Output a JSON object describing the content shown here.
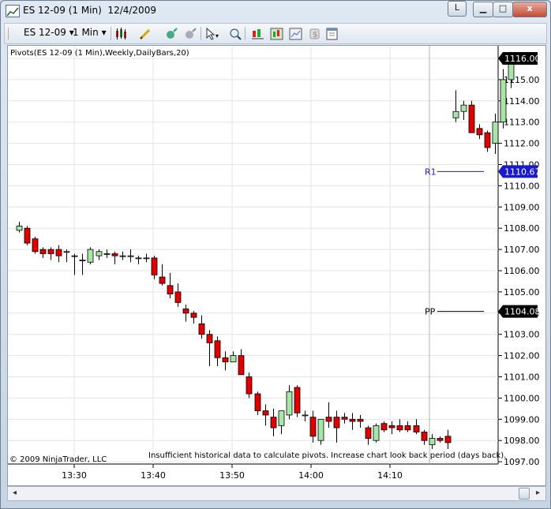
{
  "window": {
    "title": "ES 12-09 (1 Min)  12/4/2009",
    "minimize_label": "▁",
    "maximize_label": "□",
    "close_label": "x",
    "restore_label": "L"
  },
  "toolbar": {
    "instrument": "ES 12-09",
    "interval": "1 Min",
    "dropdown_glyph": "▾",
    "icons": [
      "bar-type-icon",
      "drawing-tools-icon",
      "indicators-icon",
      "strategies-icon",
      "cursor-icon",
      "zoom-icon",
      "data-box-icon",
      "chart-style-icon",
      "properties-icon",
      "reset-icon",
      "print-icon"
    ]
  },
  "chart": {
    "indicator_label": "Pivots(ES 12-09 (1 Min),Weekly,DailyBars,20)",
    "copyright": "© 2009 NinjaTrader, LLC",
    "message": "Insufficient historical data to calculate pivots. Increase chart look back period (days back).",
    "price_labels": [
      "1116.00",
      "1115.00",
      "1114.00",
      "1113.00",
      "1112.00",
      "1111.00",
      "1110.00",
      "1109.00",
      "1108.00",
      "1107.00",
      "1106.00",
      "1105.00",
      "1104.00",
      "1103.00",
      "1102.00",
      "1101.00",
      "1100.00",
      "1099.00",
      "1098.00",
      "1097.00"
    ],
    "time_labels": [
      "13:30",
      "13:40",
      "13:50",
      "14:00",
      "14:10"
    ],
    "last_price_marker": "1116.00",
    "r1": {
      "label": "R1",
      "value": "1110.67",
      "color": "#1a1acc"
    },
    "pp": {
      "label": "PP",
      "value": "1104.08",
      "color": "#000000"
    },
    "up_color": "#a8e6a8",
    "down_color": "#e00000"
  },
  "chart_data": {
    "type": "candlestick",
    "ylim": [
      1097,
      1116.5
    ],
    "bars": [
      {
        "o": 1107.9,
        "h": 1108.3,
        "l": 1107.8,
        "c": 1108.1
      },
      {
        "o": 1108.0,
        "h": 1108.1,
        "l": 1107.2,
        "c": 1107.3
      },
      {
        "o": 1107.5,
        "h": 1107.6,
        "l": 1106.8,
        "c": 1106.9
      },
      {
        "o": 1107.0,
        "h": 1107.1,
        "l": 1106.6,
        "c": 1106.8
      },
      {
        "o": 1107.0,
        "h": 1107.1,
        "l": 1106.5,
        "c": 1106.8
      },
      {
        "o": 1107.0,
        "h": 1107.2,
        "l": 1106.4,
        "c": 1106.7
      },
      {
        "o": 1106.9,
        "h": 1107.0,
        "l": 1106.4,
        "c": 1106.9
      },
      {
        "o": 1106.7,
        "h": 1106.8,
        "l": 1105.8,
        "c": 1106.7
      },
      {
        "o": 1106.5,
        "h": 1106.8,
        "l": 1105.8,
        "c": 1106.5
      },
      {
        "o": 1106.4,
        "h": 1107.1,
        "l": 1106.3,
        "c": 1107.0
      },
      {
        "o": 1106.7,
        "h": 1107.0,
        "l": 1106.5,
        "c": 1106.9
      },
      {
        "o": 1106.8,
        "h": 1107.0,
        "l": 1106.6,
        "c": 1106.8
      },
      {
        "o": 1106.8,
        "h": 1106.9,
        "l": 1106.3,
        "c": 1106.7
      },
      {
        "o": 1106.7,
        "h": 1106.9,
        "l": 1106.5,
        "c": 1106.7
      },
      {
        "o": 1106.7,
        "h": 1107.0,
        "l": 1106.4,
        "c": 1106.7
      },
      {
        "o": 1106.6,
        "h": 1106.7,
        "l": 1106.3,
        "c": 1106.6
      },
      {
        "o": 1106.6,
        "h": 1106.8,
        "l": 1106.4,
        "c": 1106.6
      },
      {
        "o": 1106.6,
        "h": 1106.7,
        "l": 1105.6,
        "c": 1105.8
      },
      {
        "o": 1105.7,
        "h": 1106.3,
        "l": 1105.3,
        "c": 1105.4
      },
      {
        "o": 1105.3,
        "h": 1105.9,
        "l": 1104.7,
        "c": 1104.9
      },
      {
        "o": 1105.0,
        "h": 1105.4,
        "l": 1104.3,
        "c": 1104.5
      },
      {
        "o": 1104.2,
        "h": 1104.4,
        "l": 1103.6,
        "c": 1104.0
      },
      {
        "o": 1104.0,
        "h": 1104.1,
        "l": 1103.5,
        "c": 1103.8
      },
      {
        "o": 1103.5,
        "h": 1103.9,
        "l": 1102.8,
        "c": 1103.0
      },
      {
        "o": 1103.0,
        "h": 1103.2,
        "l": 1101.5,
        "c": 1102.6
      },
      {
        "o": 1102.7,
        "h": 1102.9,
        "l": 1101.5,
        "c": 1101.9
      },
      {
        "o": 1101.9,
        "h": 1102.2,
        "l": 1101.3,
        "c": 1101.7
      },
      {
        "o": 1101.7,
        "h": 1102.2,
        "l": 1101.7,
        "c": 1102.0
      },
      {
        "o": 1102.0,
        "h": 1102.3,
        "l": 1101.1,
        "c": 1101.1
      },
      {
        "o": 1101.0,
        "h": 1101.2,
        "l": 1100.0,
        "c": 1100.2
      },
      {
        "o": 1100.2,
        "h": 1100.3,
        "l": 1099.2,
        "c": 1099.4
      },
      {
        "o": 1099.4,
        "h": 1099.7,
        "l": 1098.7,
        "c": 1099.2
      },
      {
        "o": 1099.1,
        "h": 1099.5,
        "l": 1098.2,
        "c": 1098.6
      },
      {
        "o": 1098.7,
        "h": 1099.4,
        "l": 1098.3,
        "c": 1099.4
      },
      {
        "o": 1099.2,
        "h": 1100.6,
        "l": 1099.0,
        "c": 1100.3
      },
      {
        "o": 1100.5,
        "h": 1100.6,
        "l": 1099.1,
        "c": 1099.3
      },
      {
        "o": 1099.2,
        "h": 1099.4,
        "l": 1098.9,
        "c": 1099.2
      },
      {
        "o": 1099.1,
        "h": 1099.4,
        "l": 1097.9,
        "c": 1098.2
      },
      {
        "o": 1098.0,
        "h": 1099.0,
        "l": 1097.8,
        "c": 1099.0
      },
      {
        "o": 1099.1,
        "h": 1099.8,
        "l": 1098.6,
        "c": 1098.9
      },
      {
        "o": 1099.1,
        "h": 1099.4,
        "l": 1097.9,
        "c": 1098.6
      },
      {
        "o": 1099.1,
        "h": 1099.3,
        "l": 1098.8,
        "c": 1099.0
      },
      {
        "o": 1099.0,
        "h": 1099.3,
        "l": 1098.5,
        "c": 1098.9
      },
      {
        "o": 1099.0,
        "h": 1099.2,
        "l": 1098.6,
        "c": 1098.9
      },
      {
        "o": 1098.6,
        "h": 1098.7,
        "l": 1097.8,
        "c": 1098.1
      },
      {
        "o": 1098.0,
        "h": 1098.8,
        "l": 1097.9,
        "c": 1098.7
      },
      {
        "o": 1098.8,
        "h": 1098.9,
        "l": 1098.4,
        "c": 1098.5
      },
      {
        "o": 1098.7,
        "h": 1098.9,
        "l": 1098.3,
        "c": 1098.6
      },
      {
        "o": 1098.7,
        "h": 1099.0,
        "l": 1098.4,
        "c": 1098.5
      },
      {
        "o": 1098.7,
        "h": 1098.9,
        "l": 1098.4,
        "c": 1098.5
      },
      {
        "o": 1098.7,
        "h": 1099.0,
        "l": 1098.3,
        "c": 1098.4
      },
      {
        "o": 1098.4,
        "h": 1098.5,
        "l": 1097.8,
        "c": 1098.0
      },
      {
        "o": 1097.8,
        "h": 1098.3,
        "l": 1097.6,
        "c": 1098.1
      },
      {
        "o": 1098.1,
        "h": 1098.2,
        "l": 1097.9,
        "c": 1098.0
      },
      {
        "o": 1098.2,
        "h": 1098.5,
        "l": 1097.6,
        "c": 1097.9
      },
      {
        "o": 1113.2,
        "h": 1114.5,
        "l": 1113.0,
        "c": 1113.5
      },
      {
        "o": 1113.5,
        "h": 1114.0,
        "l": 1113.1,
        "c": 1113.8
      },
      {
        "o": 1113.8,
        "h": 1114.0,
        "l": 1112.5,
        "c": 1112.5
      },
      {
        "o": 1112.7,
        "h": 1112.9,
        "l": 1112.2,
        "c": 1112.4
      },
      {
        "o": 1112.5,
        "h": 1112.6,
        "l": 1111.6,
        "c": 1111.8
      },
      {
        "o": 1112.0,
        "h": 1113.4,
        "l": 1111.5,
        "c": 1113.0
      },
      {
        "o": 1113.0,
        "h": 1115.5,
        "l": 1112.7,
        "c": 1115.0
      },
      {
        "o": 1115.0,
        "h": 1116.3,
        "l": 1114.6,
        "c": 1116.0
      }
    ],
    "pivots": {
      "R1": 1110.67,
      "PP": 1104.08
    },
    "time_ticks": [
      "13:30",
      "13:40",
      "13:50",
      "14:00",
      "14:10"
    ]
  }
}
